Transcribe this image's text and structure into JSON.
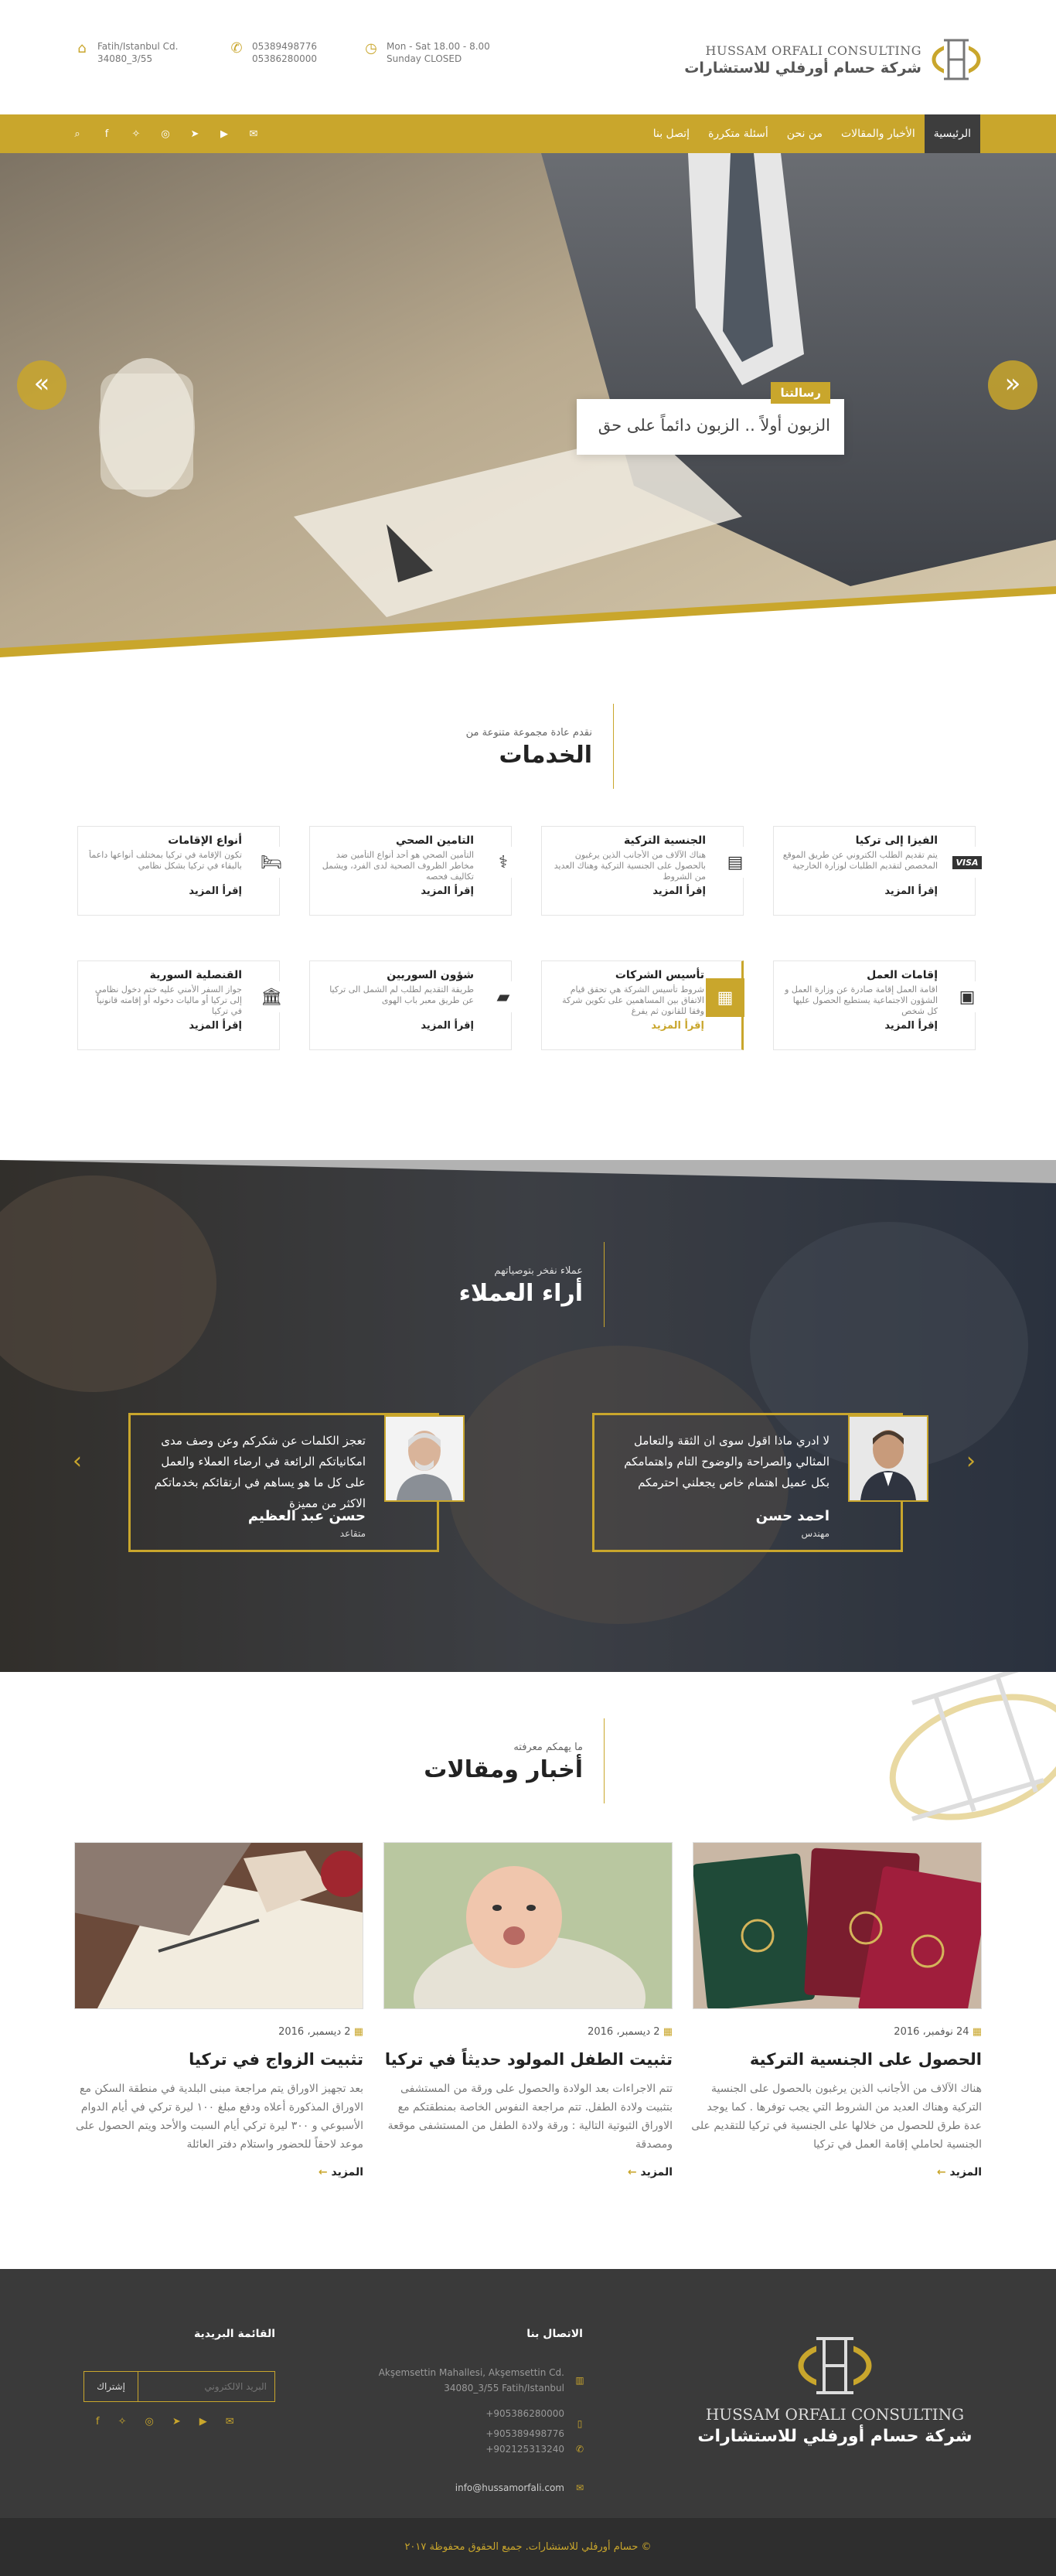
{
  "header": {
    "logo_en": "HUSSAM ORFALI CONSULTING",
    "logo_ar": "شركة حسام أورفلي للاستشارات",
    "address_line1": "Fatih/Istanbul Cd.",
    "address_line2": "34080_3/55",
    "phone1": "05389498776",
    "phone2": "05386280000",
    "hours_line1": "Mon - Sat 18.00 - 8.00",
    "hours_line2": "Sunday CLOSED",
    "icons": {
      "address": "home-icon",
      "phone": "phone-icon",
      "hours": "clock-icon"
    }
  },
  "nav": {
    "items": [
      "الرئيسية",
      "الأخبار والمقالات",
      "من نحن",
      "أسئلة متكررة",
      "إتصل بنا"
    ],
    "social": [
      "envelope-icon",
      "youtube-icon",
      "telegram-icon",
      "instagram-icon",
      "twitter-icon",
      "facebook-icon",
      "search-icon"
    ]
  },
  "hero": {
    "tag": "رسالتنا",
    "caption": "الزبون أولاً .. الزبون دائماً على حق"
  },
  "services": {
    "subtitle": "نقدم عادة مجموعة متنوعة من",
    "title": "الخدمات",
    "items": [
      {
        "title": "الفيزا إلى تركيا",
        "desc": "يتم تقديم الطلب الكتروني عن طريق الموقع المخصص لتقديم الطلبات لوزارة الخارجية",
        "more": "إقرأ المزيد",
        "icon": "visa-icon"
      },
      {
        "title": "الجنسية التركية",
        "desc": "هناك الآلاف من الأجانب الذين يرغبون بالحصول على الجنسية التركية وهناك العديد من الشروط",
        "more": "إقرأ المزيد",
        "icon": "id-card-icon"
      },
      {
        "title": "التامين الصحي",
        "desc": "التأمين الصحي هو أحد أنواع التأمين ضد مخاطر الظروف الصحية لدى الفرد، ويشمل تكاليف فحصه",
        "more": "إقرأ المزيد",
        "icon": "stethoscope-icon"
      },
      {
        "title": "أنواع الإقامات",
        "desc": "تكون الإقامة في تركيا بمختلف أنواعها داعماً بالبقاء في تركيا بشكل نظامي",
        "more": "إقرأ المزيد",
        "icon": "bed-icon"
      },
      {
        "title": "إقامات العمل",
        "desc": "اقامة العمل إقامة صادرة عن وزارة العمل و الشؤون الاجتماعية يستطيع الحصول عليها كل شخص",
        "more": "إقرأ المزيد",
        "icon": "badge-icon"
      },
      {
        "title": "تأسيس الشركات",
        "desc": "شروط تأسيس الشركة هي تحقق قيام الاتفاق بين المساهمين على تكوين شركة وفقا للقانون ثم يفرغ",
        "more": "إقرأ المزيد",
        "icon": "document-icon"
      },
      {
        "title": "شؤون السوريين",
        "desc": "طريقة التقديم لطلب لم الشمل الى تركيا عن طريق معبر باب الهوى",
        "more": "إقرأ المزيد",
        "icon": "book-icon"
      },
      {
        "title": "القنصلية السورية",
        "desc": "جواز السفر الأمني عليه ختم دخول نظامي إلى تركيا أو ماليات دخوله أو إقامته قانونياً في تركيا",
        "more": "إقرأ المزيد",
        "icon": "bank-icon"
      }
    ]
  },
  "testimonials": {
    "subtitle": "عملاء نفخر بتوصياتهم",
    "title": "أراء العملاء",
    "items": [
      {
        "quote": "لا ادري ماذا اقول سوى ان الثقة والتعامل المثالي والصراحة والوضوح التام واهتمامكم بكل عميل اهتمام خاص يجعلني احترمكم",
        "name": "احمد حسن",
        "role": "مهندس"
      },
      {
        "quote": "تعجز الكلمات عن شكركم وعن وصف مدى امكانياتكم الرائعة في ارضاء العملاء والعمل على كل ما هو يساهم في ارتقائكم بخدماتكم الاكثر من مميزة",
        "name": "حسن عبد العظيم",
        "role": "متقاعد"
      }
    ]
  },
  "news": {
    "subtitle": "ما يهمكم معرفته",
    "title": "أخبار ومقالات",
    "items": [
      {
        "date": "24 نوفمبر، 2016",
        "title": "الحصول على الجنسية التركية",
        "desc": "هناك الآلاف من الأجانب الذين يرغبون بالحصول على الجنسية التركية وهناك العديد من الشروط التي يجب توفرها . كما يوجد عدة طرق للحصول من خلالها على الجنسية في تركيا للتقديم على الجنسية لحاملي إقامة العمل في تركيا",
        "more": "المزيد"
      },
      {
        "date": "2 ديسمبر، 2016",
        "title": "تثبيت الطفل المولود حديثاً في تركيا",
        "desc": "تتم الاجراءات بعد الولادة والحصول على ورقة من المستشفى بتثبيت ولادة الطفل. تتم مراجعة النفوس الخاصة بمنطقتكم مع الاوراق الثبوتية التالية : ورقة ولادة الطفل من المستشفى موقعة ومصدقة",
        "more": "المزيد"
      },
      {
        "date": "2 ديسمبر، 2016",
        "title": "تثبيت الزواج في تركيا",
        "desc": "بعد تجهيز الاوراق يتم مراجعة مبنى البلدية في منطقة السكن مع الاوراق المذكورة أعلاه ودفع مبلغ ١٠٠ ليرة تركي في أيام الدوام الأسبوعي و ٣٠٠ ليرة تركي أيام السبت والأحد ويتم الحصول على موعد لاحقاً للحضور واستلام دفتر العائلة",
        "more": "المزيد"
      }
    ]
  },
  "footer": {
    "contact_title": "الاتصال بنا",
    "address": "Akşemsettin Mahallesi, Akşemsettin Cd.",
    "address2": "34080_3/55 Fatih/Istanbul",
    "phones": [
      "+905386280000",
      "+905389498776",
      "+902125313240"
    ],
    "email": "info@hussamorfali.com",
    "newsletter_title": "القائمة البريدية",
    "email_placeholder": "البريد الالكتروني",
    "subscribe": "إشتراك",
    "copyright": "حسام أورفلي للاستشارات. جميع الحقوق محفوظة ٢٠١٧ ©"
  }
}
